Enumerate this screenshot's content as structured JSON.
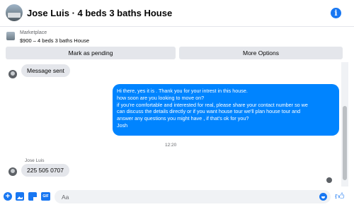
{
  "header": {
    "title": "Jose Luis · 4 beds 3 baths House",
    "info_icon": "info-icon"
  },
  "listing": {
    "category": "Marketplace",
    "title": "$900 – 4 beds 3 baths House"
  },
  "actions": {
    "mark_pending": "Mark as pending",
    "more_options": "More Options"
  },
  "messages": {
    "first": "Message sent",
    "outgoing_lines": [
      "Hi there, yes it is . Thank you for your intrest in this house.",
      "how soon are you looking to move on?",
      "if you're comfortable and interested for real, please share your contact number so we",
      "can discuss the details directly or if you  want house tour we'll plan house tour and",
      "answer any questions you might have , if that's ok for you?",
      "Josh"
    ],
    "timestamp": "12:20",
    "sender": "Jose Luis",
    "last": "225 505 0707"
  },
  "composer": {
    "placeholder": "Aa"
  },
  "colors": {
    "accent": "#1877f2",
    "outgoing_bubble": "#0084ff",
    "incoming_bubble": "#e4e6eb"
  }
}
